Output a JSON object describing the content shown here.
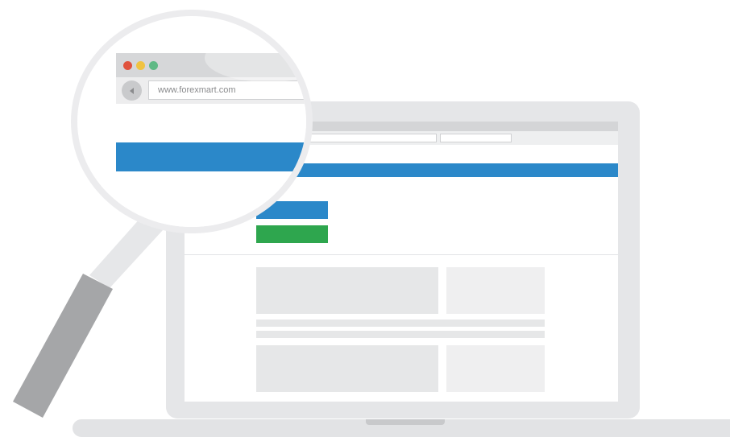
{
  "browser": {
    "url": "www.forexmart.com",
    "back_icon": "back-arrow-icon",
    "window_dots": [
      {
        "name": "close-dot",
        "color": "#e0533e"
      },
      {
        "name": "minimize-dot",
        "color": "#f0c341"
      },
      {
        "name": "maximize-dot",
        "color": "#5fb985"
      }
    ]
  },
  "colors": {
    "accent_blue": "#2b88c9",
    "accent_green": "#2ea64e",
    "device_gray": "#e5e6e8",
    "handle_gray": "#a5a6a8"
  }
}
